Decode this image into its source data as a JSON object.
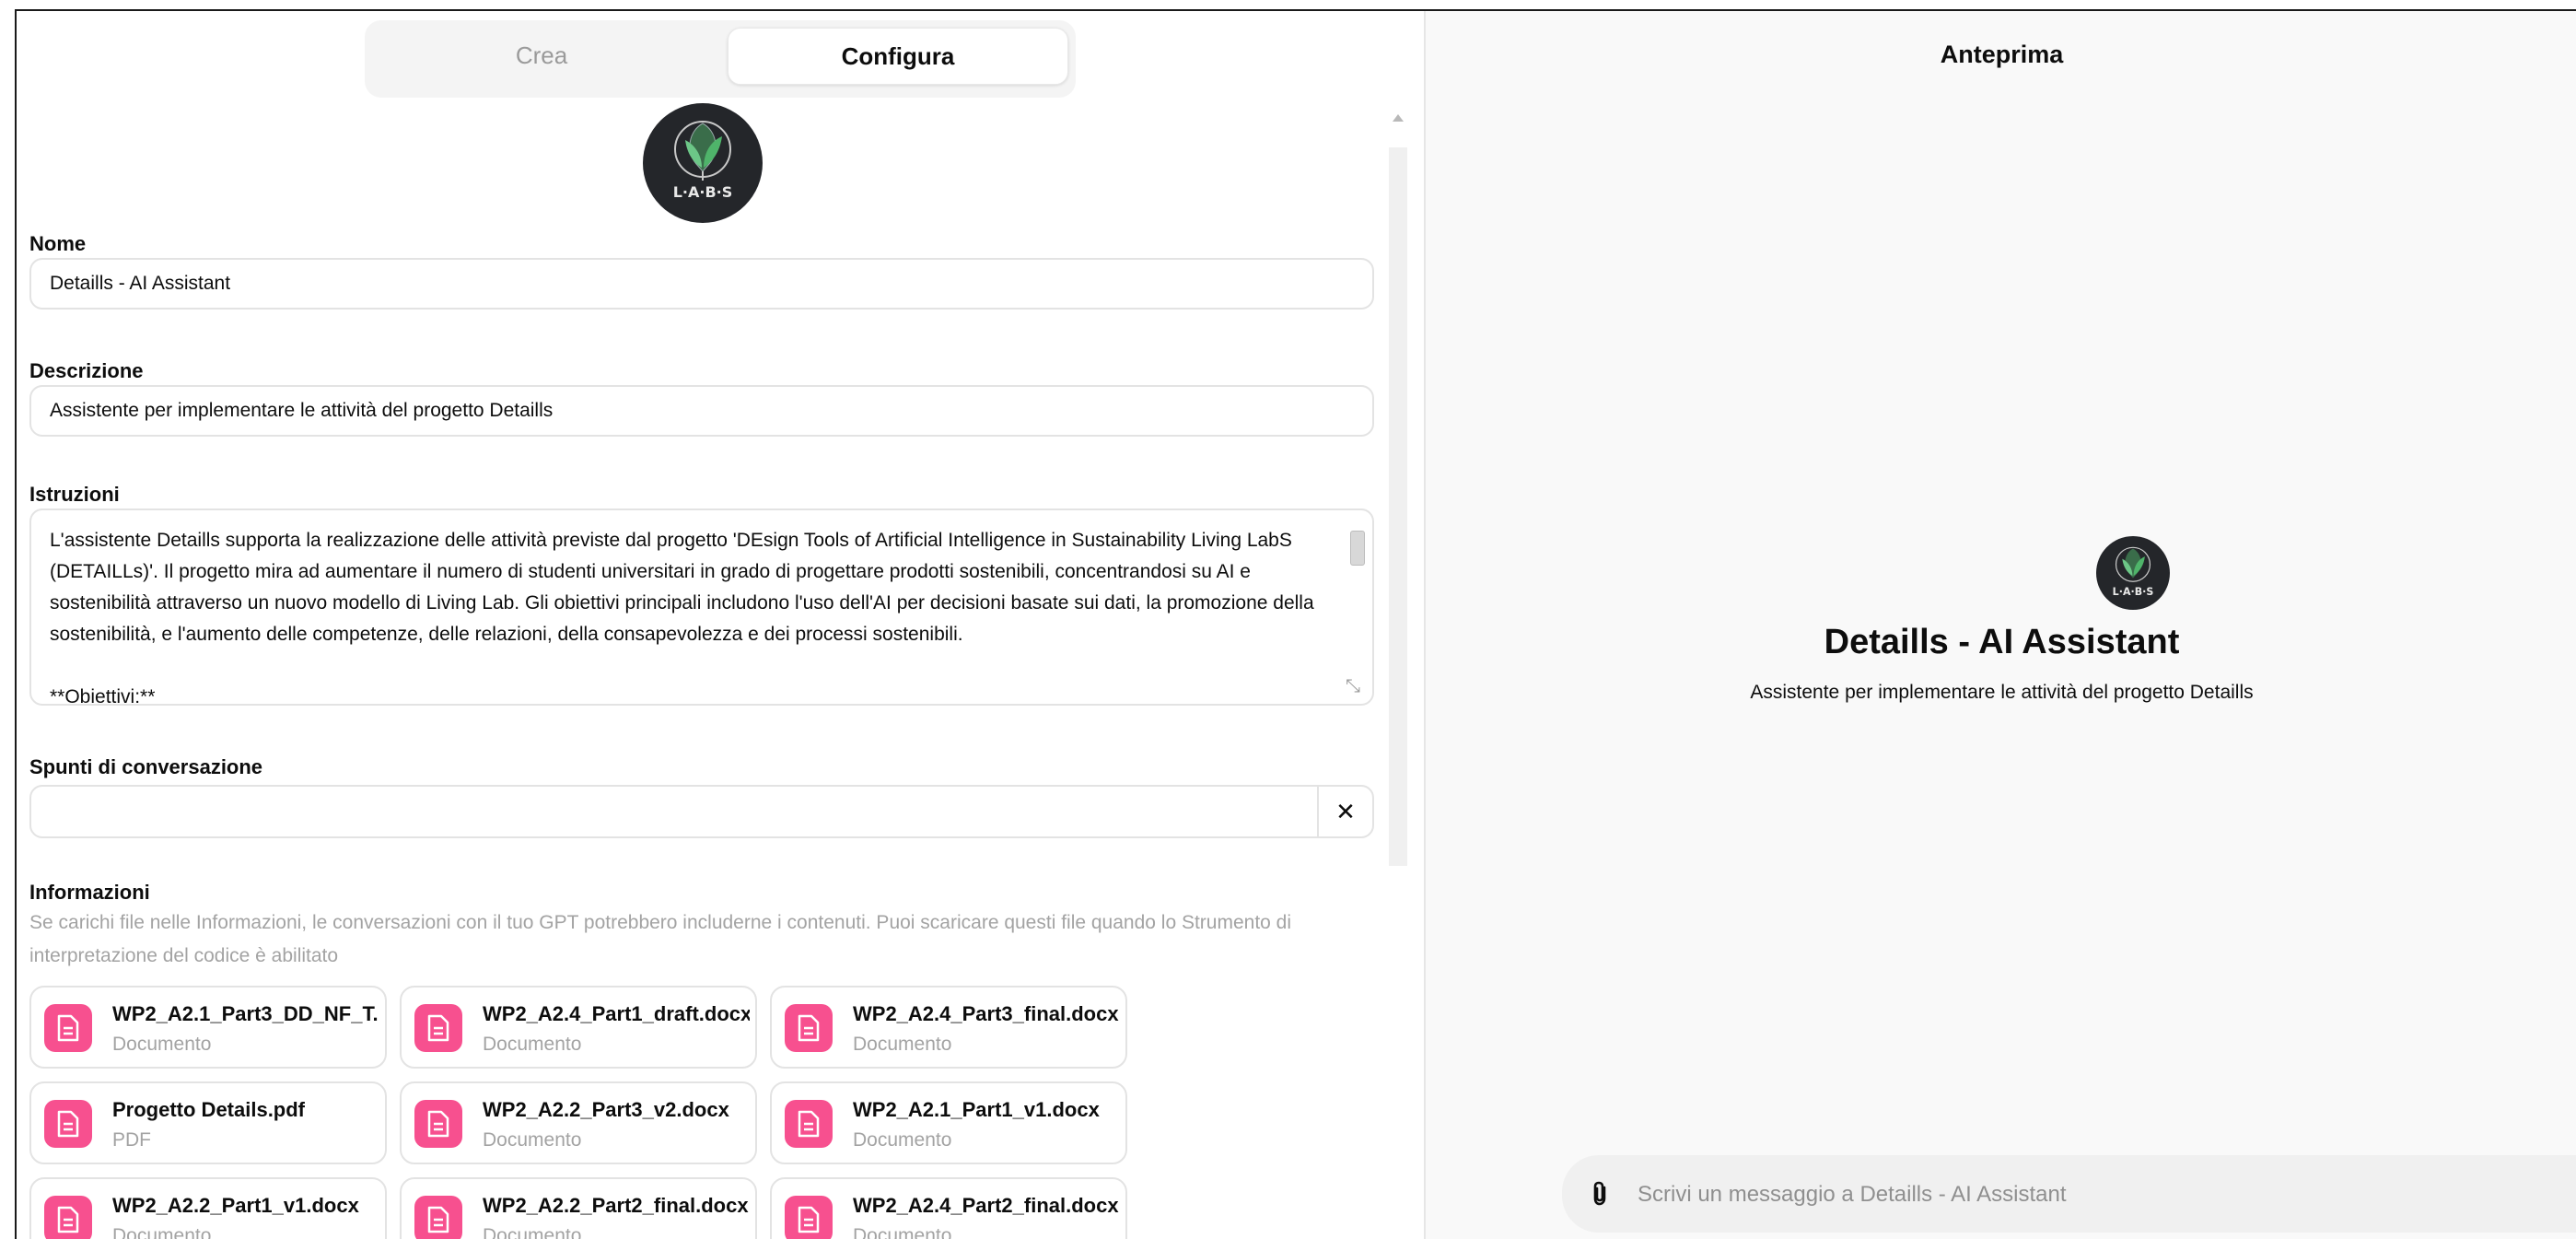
{
  "tabs": {
    "create": "Crea",
    "configure": "Configura"
  },
  "logo": {
    "text": "L·A·B·S",
    "colors": {
      "bg": "#24262a",
      "leaf": "#4fb46a",
      "ring": "#c8c8c8"
    }
  },
  "form": {
    "name_label": "Nome",
    "name_value": "Detaills - AI Assistant",
    "description_label": "Descrizione",
    "description_value": "Assistente per implementare le attività del progetto Detaills",
    "instructions_label": "Istruzioni",
    "instructions_text": "L'assistente Detaills supporta la realizzazione delle attività previste dal progetto 'DEsign Tools of Artificial Intelligence in Sustainability Living LabS (DETAILLs)'. Il progetto mira ad aumentare il numero di studenti universitari in grado di progettare prodotti sostenibili, concentrandosi su AI e sostenibilità attraverso un nuovo modello di Living Lab. Gli obiettivi principali includono l'uso dell'AI per decisioni basate sui dati, la promozione della sostenibilità, e l'aumento delle competenze, delle relazioni, della consapevolezza e dei processi sostenibili.",
    "instructions_text2": "**Obiettivi:**",
    "starters_label": "Spunti di conversazione",
    "starters_value": "",
    "knowledge_label": "Informazioni",
    "knowledge_desc": "Se carichi file nelle Informazioni, le conversazioni con il tuo GPT potrebbero includerne i contenuti. Puoi scaricare questi file quando lo Strumento di interpretazione del codice è abilitato"
  },
  "files": [
    {
      "name": "WP2_A2.1_Part3_DD_NF_T...",
      "type": "Documento"
    },
    {
      "name": "WP2_A2.4_Part1_draft.docx",
      "type": "Documento"
    },
    {
      "name": "WP2_A2.4_Part3_final.docx",
      "type": "Documento"
    },
    {
      "name": "Progetto Details.pdf",
      "type": "PDF"
    },
    {
      "name": "WP2_A2.2_Part3_v2.docx",
      "type": "Documento"
    },
    {
      "name": "WP2_A2.1_Part1_v1.docx",
      "type": "Documento"
    },
    {
      "name": "WP2_A2.2_Part1_v1.docx",
      "type": "Documento"
    },
    {
      "name": "WP2_A2.2_Part2_final.docx",
      "type": "Documento"
    },
    {
      "name": "WP2_A2.4_Part2_final.docx",
      "type": "Documento"
    }
  ],
  "preview": {
    "title": "Anteprima",
    "gpt_name": "Detaills - AI Assistant",
    "gpt_desc": "Assistente per implementare le attività del progetto Detaills",
    "composer_placeholder": "Scrivi un messaggio a Detaills - AI Assistant"
  },
  "colors": {
    "file_icon": "#f7508f",
    "muted_text": "#a3a3a3",
    "border": "#e3e3e3",
    "preview_bg": "#f9f9f9"
  }
}
